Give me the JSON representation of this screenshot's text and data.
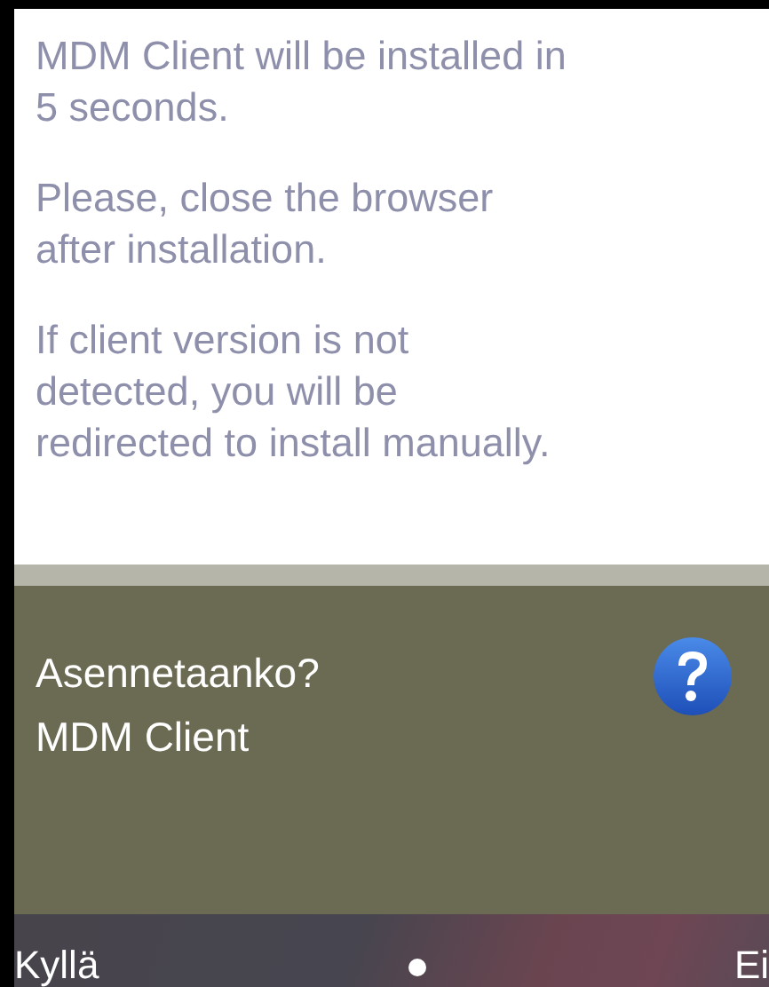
{
  "page": {
    "paragraphs": [
      "MDM Client will be installed in\n5 seconds.",
      "Please, close the browser\nafter installation.",
      "If client version is not\ndetected, you will be\nredirected to install manually."
    ]
  },
  "dialog": {
    "question": "Asennetaanko?",
    "item": "MDM Client"
  },
  "softkeys": {
    "left": "Kyllä",
    "right": "Ei"
  }
}
